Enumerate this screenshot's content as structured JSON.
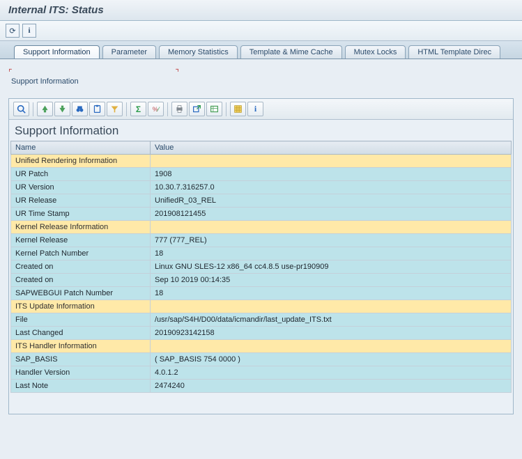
{
  "title": "Internal ITS: Status",
  "top_icons": {
    "refresh": "⟳",
    "info": "i"
  },
  "tabs": [
    "Support Information",
    "Parameter",
    "Memory Statistics",
    "Template & Mime Cache",
    "Mutex Locks",
    "HTML Template Direc"
  ],
  "section_label": "Support Information",
  "panel_title": "Support Information",
  "columns": {
    "name": "Name",
    "value": "Value"
  },
  "toolbar_icons": [
    "details",
    "print",
    "sort",
    "find",
    "paste",
    "filter",
    "|",
    "sum",
    "subtotal",
    "|",
    "layout",
    "export",
    "email",
    "|",
    "grid",
    "info"
  ],
  "rows": [
    {
      "cat": true,
      "name": "Unified Rendering Information",
      "value": ""
    },
    {
      "cat": false,
      "name": "UR Patch",
      "value": "1908"
    },
    {
      "cat": false,
      "name": "UR Version",
      "value": "10.30.7.316257.0"
    },
    {
      "cat": false,
      "name": "UR Release",
      "value": "UnifiedR_03_REL"
    },
    {
      "cat": false,
      "name": "UR Time Stamp",
      "value": "201908121455"
    },
    {
      "cat": true,
      "name": "Kernel Release Information",
      "value": ""
    },
    {
      "cat": false,
      "name": "Kernel Release",
      "value": "777 (777_REL)"
    },
    {
      "cat": false,
      "name": "Kernel Patch Number",
      "value": "18"
    },
    {
      "cat": false,
      "name": "Created on",
      "value": "Linux GNU SLES-12 x86_64 cc4.8.5 use-pr190909"
    },
    {
      "cat": false,
      "name": "Created on",
      "value": "Sep 10 2019 00:14:35"
    },
    {
      "cat": false,
      "name": "SAPWEBGUI Patch Number",
      "value": "18"
    },
    {
      "cat": true,
      "name": "ITS Update Information",
      "value": ""
    },
    {
      "cat": false,
      "name": "File",
      "value": "/usr/sap/S4H/D00/data/icmandir/last_update_ITS.txt"
    },
    {
      "cat": false,
      "name": "Last Changed",
      "value": "20190923142158"
    },
    {
      "cat": true,
      "name": "ITS Handler Information",
      "value": ""
    },
    {
      "cat": false,
      "name": "SAP_BASIS",
      "value": "( SAP_BASIS 754 0000 )"
    },
    {
      "cat": false,
      "name": "Handler Version",
      "value": "4.0.1.2"
    },
    {
      "cat": false,
      "name": "Last Note",
      "value": "2474240"
    }
  ]
}
